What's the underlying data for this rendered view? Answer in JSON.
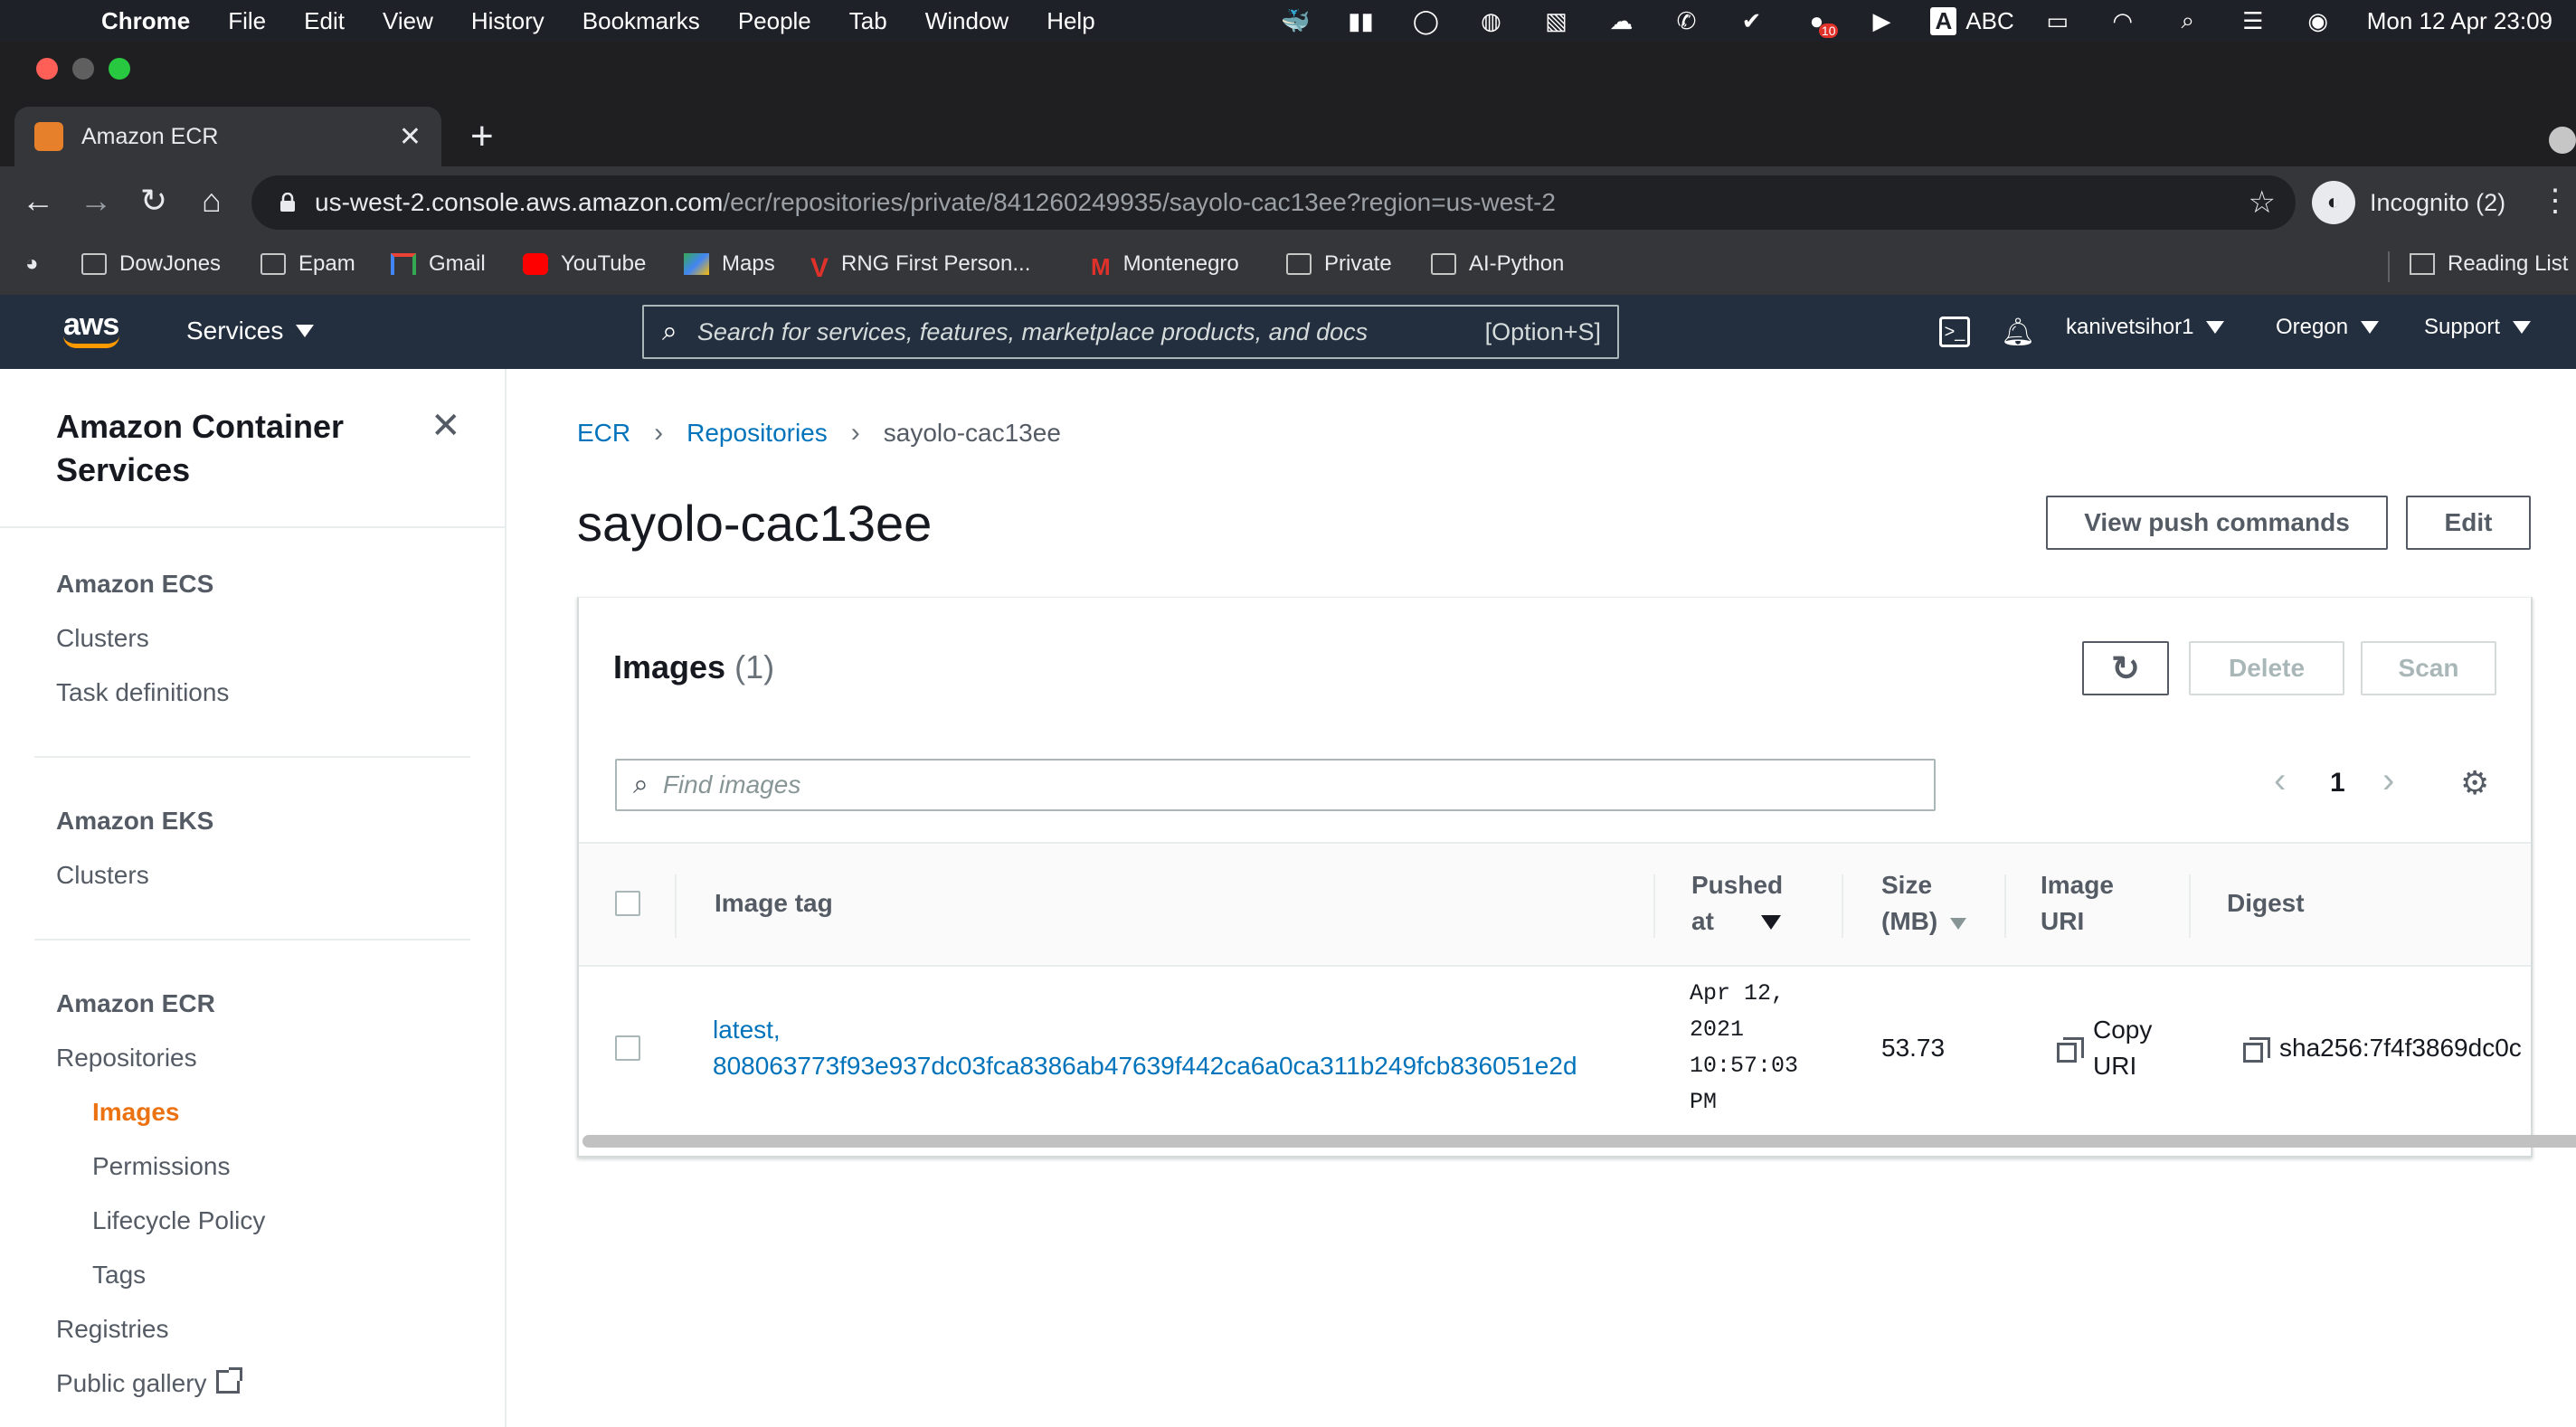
{
  "macos": {
    "app": "Chrome",
    "menu": [
      "File",
      "Edit",
      "View",
      "History",
      "Bookmarks",
      "People",
      "Tab",
      "Window",
      "Help"
    ],
    "input_source": "ABC",
    "clock": "Mon 12 Apr  23:09",
    "notification_badge": "10"
  },
  "browser": {
    "tab_title": "Amazon ECR",
    "url_host": "us-west-2.console.aws.amazon.com",
    "url_path": "/ecr/repositories/private/841260249935/sayolo-cac13ee?region=us-west-2",
    "profile": "Incognito (2)",
    "bookmarks": [
      "DowJones",
      "Epam",
      "Gmail",
      "YouTube",
      "Maps",
      "RNG First Person...",
      "Montenegro",
      "Private",
      "AI-Python"
    ],
    "reading_list": "Reading List"
  },
  "aws": {
    "logo": "aws",
    "services": "Services",
    "search_placeholder": "Search for services, features, marketplace products, and docs",
    "search_shortcut": "[Option+S]",
    "user": "kanivetsihor1",
    "region": "Oregon",
    "support": "Support"
  },
  "sidebar": {
    "title": "Amazon Container Services",
    "ecs_heading": "Amazon ECS",
    "ecs_items": [
      "Clusters",
      "Task definitions"
    ],
    "eks_heading": "Amazon EKS",
    "eks_items": [
      "Clusters"
    ],
    "ecr_heading": "Amazon ECR",
    "ecr_repositories": "Repositories",
    "ecr_sub_items": [
      "Images",
      "Permissions",
      "Lifecycle Policy",
      "Tags"
    ],
    "registries": "Registries",
    "public_gallery": "Public gallery",
    "active_item": "Images"
  },
  "breadcrumb": [
    "ECR",
    "Repositories",
    "sayolo-cac13ee"
  ],
  "page": {
    "title": "sayolo-cac13ee",
    "view_push_commands": "View push commands",
    "edit": "Edit"
  },
  "images_panel": {
    "title": "Images",
    "count": "(1)",
    "delete": "Delete",
    "scan": "Scan",
    "find_placeholder": "Find images",
    "page_number": "1",
    "columns": {
      "image_tag": "Image tag",
      "pushed_at_1": "Pushed",
      "pushed_at_2": "at",
      "size_1": "Size",
      "size_2": "(MB)",
      "image_uri_1": "Image",
      "image_uri_2": "URI",
      "digest": "Digest"
    },
    "rows": [
      {
        "tag_line1": "latest,",
        "tag_line2": "808063773f93e937dc03fca8386ab47639f442ca6a0ca311b249fcb836051e2d",
        "pushed_1": "Apr 12,",
        "pushed_2": "2021",
        "pushed_3": "10:57:03",
        "pushed_4": "PM",
        "size": "53.73",
        "copy_1": "Copy",
        "copy_2": "URI",
        "digest": "sha256:7f4f3869dc0c"
      }
    ]
  },
  "colors": {
    "aws_nav": "#232f3e",
    "aws_orange": "#ec7211",
    "link": "#0073bb"
  }
}
